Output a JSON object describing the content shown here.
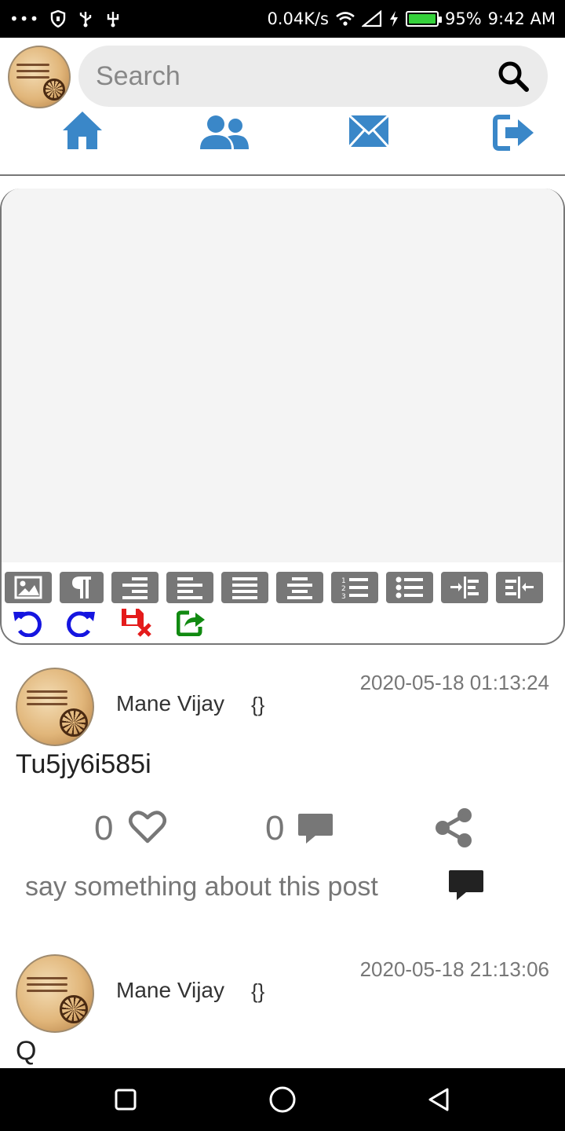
{
  "status_bar": {
    "net_speed": "0.04K/s",
    "battery_pct": "95%",
    "time": "9:42 AM",
    "battery_level": 0.95,
    "battery_color": "#35d13b"
  },
  "search": {
    "placeholder": "Search"
  },
  "nav": {
    "accent": "#3a87c8",
    "items": [
      "home-icon",
      "users-icon",
      "mail-icon",
      "logout-icon"
    ]
  },
  "editor": {
    "toolbar_row1": [
      "image-icon",
      "paragraph-icon",
      "align-right-icon",
      "align-left-icon",
      "align-justify-icon",
      "align-center-icon",
      "ordered-list-icon",
      "unordered-list-icon",
      "indent-icon",
      "outdent-icon"
    ],
    "toolbar_row2": [
      "undo-icon",
      "redo-icon",
      "discard-icon",
      "share-export-icon"
    ]
  },
  "posts": [
    {
      "author": "Mane Vijay",
      "meta": "{}",
      "date": "2020-05-18 01:13:24",
      "body": "Tu5jy6i585i",
      "likes": "0",
      "comments": "0",
      "comment_placeholder": "say something about this post"
    },
    {
      "author": "Mane Vijay",
      "meta": "{}",
      "date": "2020-05-18 21:13:06",
      "body": "Q"
    }
  ]
}
